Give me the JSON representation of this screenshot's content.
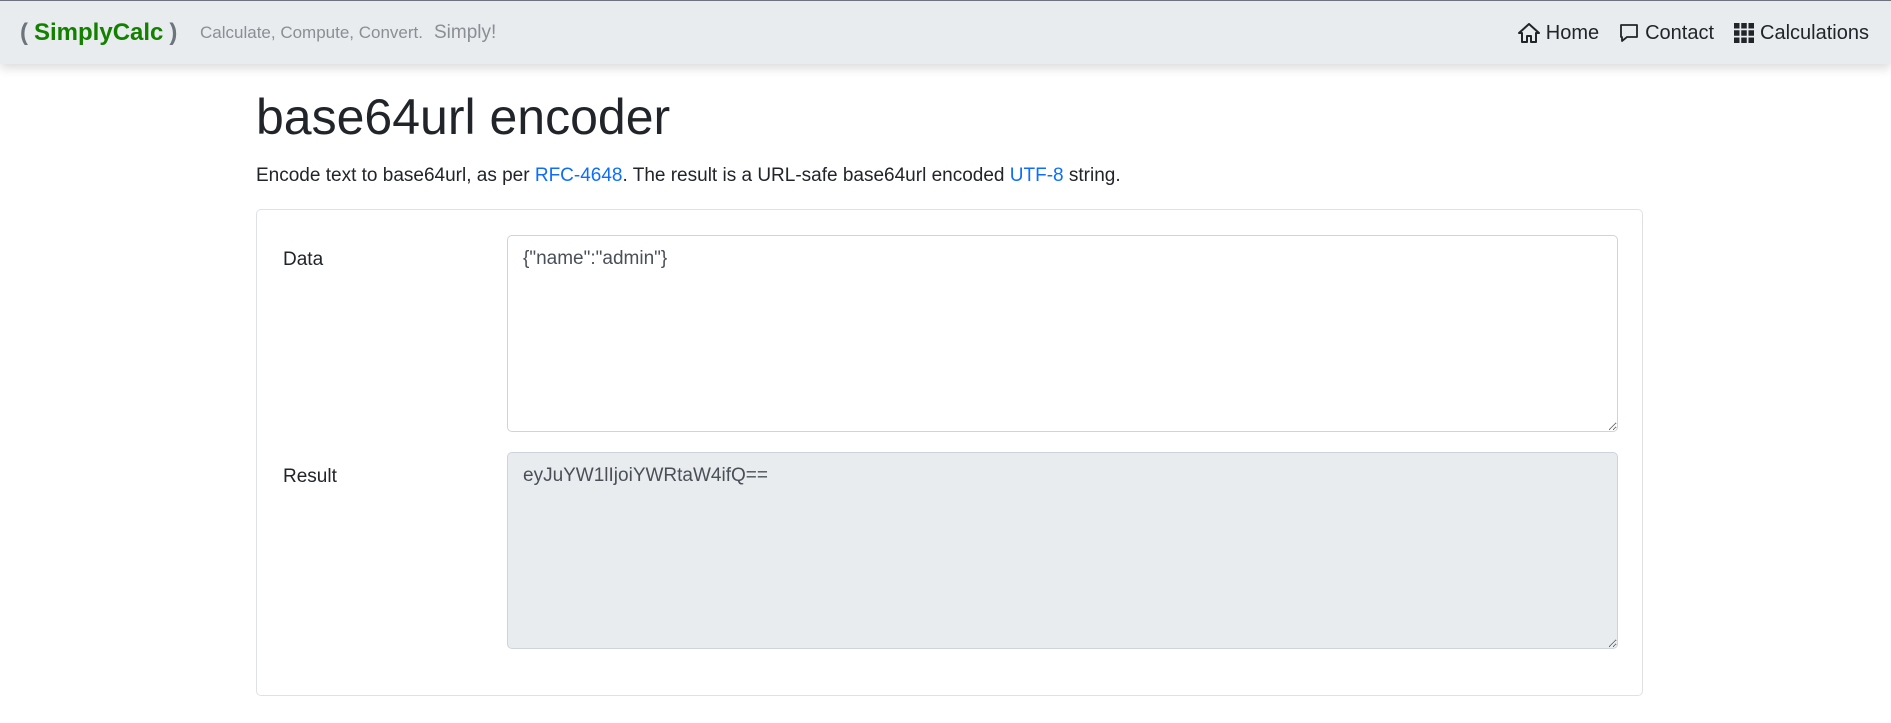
{
  "navbar": {
    "brand_open": "(",
    "brand_name": "SimplyCalc",
    "brand_close": ")",
    "tagline_main": "Calculate, Compute, Convert.",
    "tagline_accent": "Simply!",
    "links": [
      {
        "label": "Home",
        "icon": "home-icon"
      },
      {
        "label": "Contact",
        "icon": "chat-icon"
      },
      {
        "label": "Calculations",
        "icon": "grid-icon"
      }
    ]
  },
  "page": {
    "title": "base64url encoder",
    "description": {
      "part1": "Encode text to base64url, as per ",
      "link1": "RFC-4648",
      "part2": ". The result is a URL-safe base64url encoded ",
      "link2": "UTF-8",
      "part3": " string."
    }
  },
  "form": {
    "data_label": "Data",
    "data_value": "{\"name\":\"admin\"}",
    "result_label": "Result",
    "result_value": "eyJuYW1lIjoiYWRtaW4ifQ=="
  },
  "colors": {
    "brand": "#138000",
    "link": "#0d6efd",
    "navbar_bg": "#e9ecef",
    "readonly_bg": "#e9ecef"
  }
}
